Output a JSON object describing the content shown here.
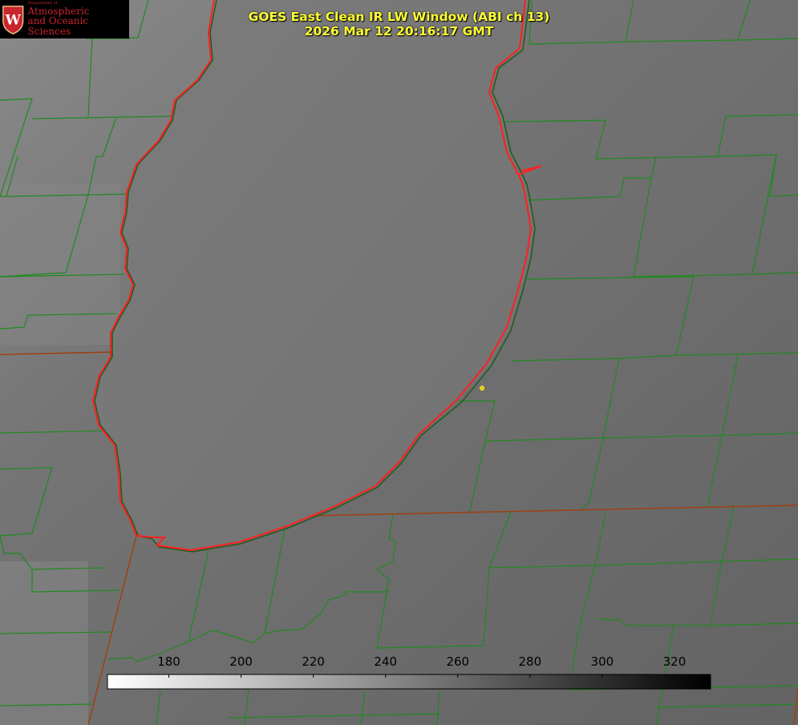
{
  "title": {
    "line1": "GOES East Clean IR LW Window (ABI ch 13)",
    "line2": "2026 Mar 12 20:16:17 GMT"
  },
  "logo": {
    "department": "Department of",
    "line1": "Atmospheric",
    "line2": "and Oceanic Sciences",
    "crest_letter": "W"
  },
  "colorbar": {
    "ticks": [
      "180",
      "200",
      "220",
      "240",
      "260",
      "280",
      "300",
      "320"
    ],
    "min": 163,
    "max": 330,
    "gradient": [
      "#ffffff",
      "#000000"
    ]
  },
  "colors": {
    "county_lines": "#1f8a1f",
    "state_lines": "#a04010",
    "coastline": "#ff2020",
    "station_marker": "#e8d020",
    "title": "#ffff33",
    "logo_text": "#c9252c"
  }
}
